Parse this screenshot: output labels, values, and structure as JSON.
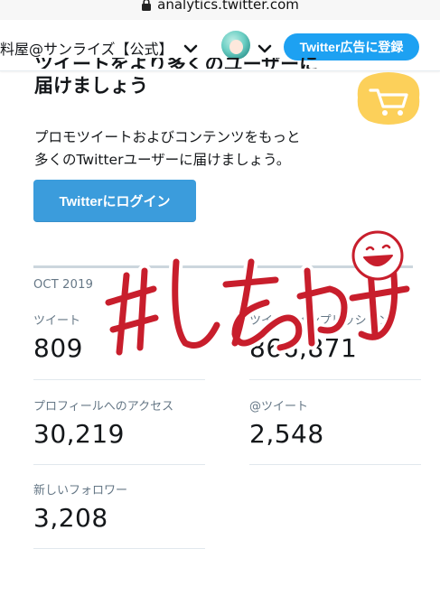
{
  "browser": {
    "url": "analytics.twitter.com"
  },
  "header": {
    "account_name": "料屋@サンライズ【公式】",
    "signup_button": "Twitter広告に登録"
  },
  "promo": {
    "headline_line1": "ツイートをより多くのユーザーに",
    "headline_line2": "届けましょう",
    "desc_line1": "プロモツイートおよびコンテンツをもっと",
    "desc_line2": "多くのTwitterユーザーに届けましょう。",
    "login_button": "Twitterにログイン"
  },
  "stats": {
    "period": "OCT 2019",
    "tweets": {
      "label": "ツイート",
      "value": "809"
    },
    "impressions": {
      "label": "ツイートインプレッション",
      "value": "866,871"
    },
    "profile_visits": {
      "label": "プロフィールへのアクセス",
      "value": "30,219"
    },
    "mentions": {
      "label": "@ツイート",
      "value": "2,548"
    },
    "new_followers": {
      "label": "新しいフォロワー",
      "value": "3,208"
    }
  },
  "overlay": {
    "handwritten_text": "#しあわせ"
  },
  "colors": {
    "accent_blue": "#1da1f2",
    "login_blue": "#3b9cdc",
    "badge_yellow": "#fcd05a",
    "overlay_red": "#c81e2c"
  }
}
